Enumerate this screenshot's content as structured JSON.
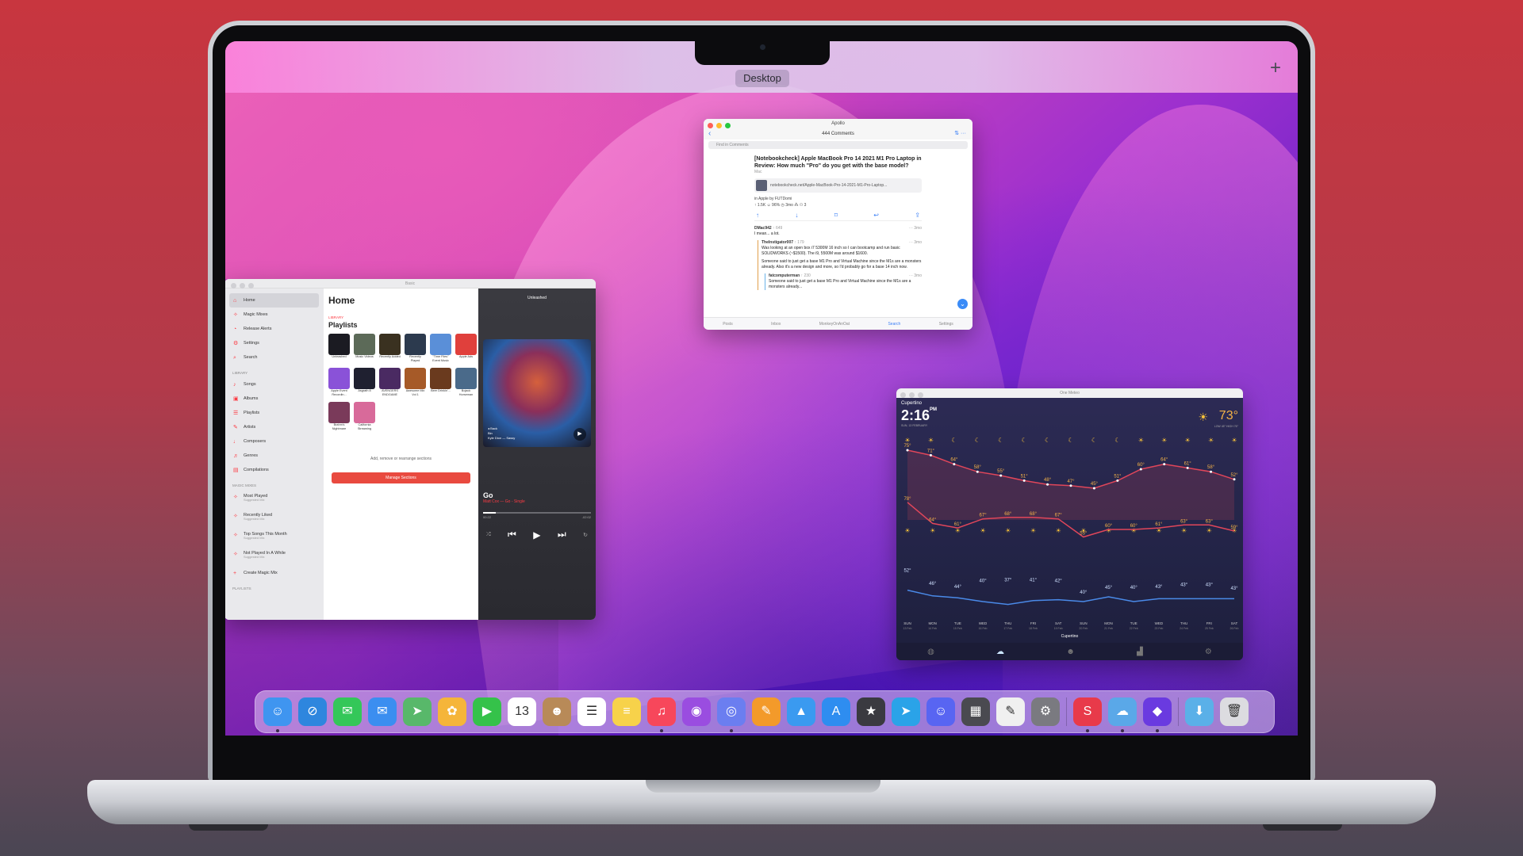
{
  "mission_control": {
    "space_label": "Desktop",
    "add_space": "+"
  },
  "apollo": {
    "window_title": "Apollo",
    "comments_count": "444 Comments",
    "find_placeholder": "Find in Comments",
    "post_title": "[Notebookcheck] Apple MacBook Pro 14 2021 M1 Pro Laptop in Review: How much \"Pro\" do you get with the base model?",
    "post_flair": "Mac",
    "link_text": "notebookcheck.net/Apple-MacBook-Pro-14-2021-M1-Pro-Laptop...",
    "subreddit_line": "in Apple by FUTDomi",
    "stats_line": "↑ 1.5K  ☺ 96%  ◷ 3mo  ⁂ ⚇ 3",
    "comments": [
      {
        "user": "DMac942",
        "score": "↑ 649",
        "time": "··· 3mo",
        "text": "I mean... a lot."
      },
      {
        "user": "TheInstigator007",
        "score": "↑ 179",
        "time": "··· 3mo",
        "text": "Was looking at an open box i7 5300M 16 inch so I can bootcamp and run basic SOLIDWORKS (~$1500). The i9, 5500M was around $1600.",
        "text2": "Someone said to just get a base M1 Pro and Virtual Machine since the M1s are a monsters already. Also it's a new design and more, so I'd probably go for a base 14 inch now."
      },
      {
        "user": "fatcomputerman",
        "score": "↑ 230",
        "time": "··· 3mo",
        "text": "Someone said to just get a base M1 Pro and Virtual Machine since the M1s are a monsters already..."
      }
    ],
    "tabs": [
      "Posts",
      "Inbox",
      "MonkeyOnAnOat",
      "Search",
      "Settings"
    ]
  },
  "music": {
    "window_title": "Basic",
    "sidebar": {
      "items": [
        "Home",
        "Magic Mixes",
        "Release Alerts",
        "Settings",
        "Search"
      ],
      "library_head": "LIBRARY",
      "library": [
        "Songs",
        "Albums",
        "Playlists",
        "Artists",
        "Composers",
        "Genres",
        "Compilations"
      ],
      "magic_head": "MAGIC MIXES",
      "magic": [
        {
          "name": "Most Played",
          "sub": "Suggested Mix"
        },
        {
          "name": "Recently Liked",
          "sub": "Suggested Mix"
        },
        {
          "name": "Top Songs This Month",
          "sub": "Suggested Mix"
        },
        {
          "name": "Not Played In A While",
          "sub": "Suggested Mix"
        }
      ],
      "create_mix": "Create Magic Mix",
      "playlists_head": "PLAYLISTS"
    },
    "main": {
      "title": "Home",
      "library_tag": "LIBRARY",
      "playlists_heading": "Playlists",
      "playlists": [
        {
          "name": "Unleashed",
          "color": "#1b1b22"
        },
        {
          "name": "Music Videos",
          "color": "#5c6a58"
        },
        {
          "name": "Recently Added",
          "color": "#3a3120"
        },
        {
          "name": "Recently Played",
          "color": "#2c3a4e"
        },
        {
          "name": "\"Time Flies\" Event Music",
          "color": "#5a8fd8"
        },
        {
          "name": "Apple Ads",
          "color": "#e0403c"
        },
        {
          "name": "Apple Event Recordin...",
          "color": "#8a52d8"
        },
        {
          "name": "Asgrath 8",
          "color": "#1f2030"
        },
        {
          "name": "AVENGERS ENDGAME",
          "color": "#4a2a62"
        },
        {
          "name": "Awesome Mix Vol 1",
          "color": "#a65a28"
        },
        {
          "name": "Beer Drinkin'...",
          "color": "#6a3a1e"
        },
        {
          "name": "Bojack Horseman",
          "color": "#4a6a8a"
        },
        {
          "name": "Brahm's Nightmare",
          "color": "#7a3a5a"
        },
        {
          "name": "California Streaming",
          "color": "#d86a9a"
        }
      ],
      "manage_text": "Add, remove or rearrange sections",
      "manage_button": "Manage Sections"
    },
    "player": {
      "top_label": "Unleashed",
      "art_back": "◂ Back",
      "art_line1": "Bin",
      "art_line2": "Kyle Dion — Sassy",
      "song": "Go",
      "artist_line": "Matt Cox — Go - Single",
      "elapsed": "00:22",
      "remaining": "-02:02",
      "progress": 0.12
    }
  },
  "weather": {
    "window_title": "One Meteo",
    "city": "Cupertino",
    "time": "2:16",
    "ampm": "PM",
    "date": "SUN, 13 FEBRUARY",
    "temp_now": "73°",
    "hi_lo": "LOW 45° HIGH 76°",
    "hourly_times": [
      "5 PM",
      "6 PM",
      "7 PM",
      "8 PM",
      "9 PM",
      "10 PM",
      "11 PM",
      "12 AM",
      "1 AM",
      "2 AM",
      "3 AM",
      "4 AM",
      "5 AM",
      "6 AM",
      "7 AM",
      "8 AM",
      "9 AM",
      "10 AM",
      "11 AM",
      "12 PM",
      "1 PM",
      "2 PM"
    ],
    "hourly_temps": [
      75,
      71,
      64,
      58,
      55,
      51,
      48,
      47,
      45,
      51,
      60,
      64,
      61,
      58,
      52
    ],
    "hourly_labels": [
      "75°",
      "71°",
      "64°",
      "58°",
      "55°",
      "51°",
      "48°",
      "47°",
      "45°",
      "51°",
      "60°",
      "64°",
      "61°",
      "58°",
      "52°"
    ],
    "daily_high": [
      "78°",
      "64°",
      "61°",
      "67°",
      "68°",
      "68°",
      "67°",
      "55°",
      "60°",
      "60°",
      "61°",
      "63°",
      "63°",
      "59°"
    ],
    "daily_low": [
      "52°",
      "46°",
      "44°",
      "40°",
      "37°",
      "41°",
      "42°",
      "40°",
      "45°",
      "40°",
      "43°",
      "43°",
      "43°",
      "43°"
    ],
    "days": [
      "SUN",
      "MON",
      "TUE",
      "WED",
      "THU",
      "FRI",
      "SAT",
      "SUN",
      "MON",
      "TUE",
      "WED",
      "THU",
      "FRI",
      "SAT"
    ],
    "day_dates": [
      "13 Feb",
      "14 Feb",
      "15 Feb",
      "16 Feb",
      "17 Feb",
      "18 Feb",
      "19 Feb",
      "20 Feb",
      "21 Feb",
      "22 Feb",
      "23 Feb",
      "24 Feb",
      "25 Feb",
      "26 Feb"
    ],
    "location_label": "Cupertino",
    "colors": {
      "high": "#e0465a",
      "low": "#4a8ae8",
      "sun": "#f8c23a"
    }
  },
  "dock": {
    "apps": [
      {
        "name": "Finder",
        "color": "#3f95f0",
        "glyph": "☺",
        "running": true
      },
      {
        "name": "Safari",
        "color": "#2e86de",
        "glyph": "⊘",
        "running": false
      },
      {
        "name": "Messages",
        "color": "#34c759",
        "glyph": "✉",
        "running": false
      },
      {
        "name": "Mail",
        "color": "#3b8ef0",
        "glyph": "✉",
        "running": false
      },
      {
        "name": "Maps",
        "color": "#58b86a",
        "glyph": "➤",
        "running": false
      },
      {
        "name": "Photos",
        "color": "#f5b53a",
        "glyph": "✿",
        "running": false
      },
      {
        "name": "FaceTime",
        "color": "#35c24a",
        "glyph": "▶",
        "running": false
      },
      {
        "name": "Calendar",
        "color": "#ffffff",
        "glyph": "13",
        "running": false
      },
      {
        "name": "Contacts",
        "color": "#b88a58",
        "glyph": "☻",
        "running": false
      },
      {
        "name": "Reminders",
        "color": "#ffffff",
        "glyph": "☰",
        "running": false
      },
      {
        "name": "Notes",
        "color": "#f7d24a",
        "glyph": "≡",
        "running": false
      },
      {
        "name": "Music",
        "color": "#f7475b",
        "glyph": "♫",
        "running": true
      },
      {
        "name": "Podcasts",
        "color": "#9a4de0",
        "glyph": "◉",
        "running": false
      },
      {
        "name": "Apollo",
        "color": "#6b7ef0",
        "glyph": "◎",
        "running": true
      },
      {
        "name": "Pages",
        "color": "#f39a2a",
        "glyph": "✎",
        "running": false
      },
      {
        "name": "Keynote",
        "color": "#3a9af0",
        "glyph": "▲",
        "running": false
      },
      {
        "name": "App Store",
        "color": "#2e8df0",
        "glyph": "A",
        "running": false
      },
      {
        "name": "Dispatch",
        "color": "#3a3a40",
        "glyph": "★",
        "running": false
      },
      {
        "name": "Telegram",
        "color": "#2aa3e8",
        "glyph": "➤",
        "running": false
      },
      {
        "name": "Discord",
        "color": "#5865f2",
        "glyph": "☺",
        "running": false
      },
      {
        "name": "Calculator",
        "color": "#4a4a50",
        "glyph": "▦",
        "running": false
      },
      {
        "name": "TextEdit",
        "color": "#f0f0f0",
        "glyph": "✎",
        "running": false
      },
      {
        "name": "System Preferences",
        "color": "#7a7a80",
        "glyph": "⚙",
        "running": false
      },
      {
        "name": "Shortcut Pro",
        "color": "#e83a4a",
        "glyph": "S",
        "running": true
      },
      {
        "name": "One Meteo",
        "color": "#5aa8e8",
        "glyph": "☁",
        "running": true
      },
      {
        "name": "Shortcuts",
        "color": "#6a3ae0",
        "glyph": "◆",
        "running": true
      },
      {
        "name": "Downloads",
        "color": "#5ab0e8",
        "glyph": "⬇",
        "running": false
      },
      {
        "name": "Trash",
        "color": "#dcdce0",
        "glyph": "🗑",
        "running": false
      }
    ]
  }
}
